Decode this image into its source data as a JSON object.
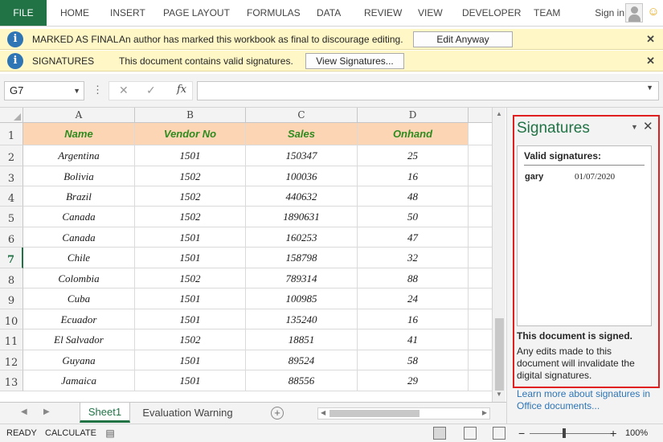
{
  "ribbon": {
    "file": "FILE",
    "tabs": [
      "HOME",
      "INSERT",
      "PAGE LAYOUT",
      "FORMULAS",
      "DATA",
      "REVIEW",
      "VIEW",
      "DEVELOPER",
      "TEAM"
    ],
    "sign_in": "Sign in",
    "accent": "#217346"
  },
  "message_bars": [
    {
      "title": "MARKED AS FINAL",
      "text": "An author has marked this workbook as final to discourage editing.",
      "button": "Edit Anyway",
      "close": "✕"
    },
    {
      "title": "SIGNATURES",
      "text": "This document contains valid signatures.",
      "button": "View Signatures...",
      "close": "✕"
    }
  ],
  "formula_bar": {
    "name_box": "G7",
    "cancel_glyph": "✕",
    "enter_glyph": "✓",
    "fx": "fx",
    "formula": ""
  },
  "grid": {
    "columns": [
      "A",
      "B",
      "C",
      "D"
    ],
    "row_numbers": [
      "1",
      "2",
      "3",
      "4",
      "5",
      "6",
      "7",
      "8",
      "9",
      "10",
      "11",
      "12",
      "13"
    ],
    "active_row": "7",
    "header": [
      "Name",
      "Vendor No",
      "Sales",
      "Onhand"
    ],
    "rows": [
      [
        "Argentina",
        "1501",
        "150347",
        "25"
      ],
      [
        "Bolivia",
        "1502",
        "100036",
        "16"
      ],
      [
        "Brazil",
        "1502",
        "440632",
        "48"
      ],
      [
        "Canada",
        "1502",
        "1890631",
        "50"
      ],
      [
        "Canada",
        "1501",
        "160253",
        "47"
      ],
      [
        "Chile",
        "1501",
        "158798",
        "32"
      ],
      [
        "Colombia",
        "1502",
        "789314",
        "88"
      ],
      [
        "Cuba",
        "1501",
        "100985",
        "24"
      ],
      [
        "Ecuador",
        "1501",
        "135240",
        "16"
      ],
      [
        "El Salvador",
        "1502",
        "18851",
        "41"
      ],
      [
        "Guyana",
        "1501",
        "89524",
        "58"
      ],
      [
        "Jamaica",
        "1501",
        "88556",
        "29"
      ]
    ],
    "header_fill": "#fcd5b4",
    "header_text_color": "#2e8b1f"
  },
  "sheets": {
    "tabs": [
      "Sheet1",
      "Evaluation Warning"
    ],
    "active": "Sheet1",
    "add_glyph": "+"
  },
  "status": {
    "ready": "READY",
    "calculate": "CALCULATE",
    "zoom_minus": "−",
    "zoom_plus": "+",
    "zoom": "100%"
  },
  "signatures_pane": {
    "title": "Signatures",
    "close": "✕",
    "valid_heading": "Valid signatures:",
    "signer": "gary",
    "date": "01/07/2020",
    "signed_heading": "This document is signed.",
    "description": "Any edits made to this document will invalidate the digital signatures.",
    "link": "Learn more about signatures in Office documents...",
    "outline_color": "#e02020"
  }
}
